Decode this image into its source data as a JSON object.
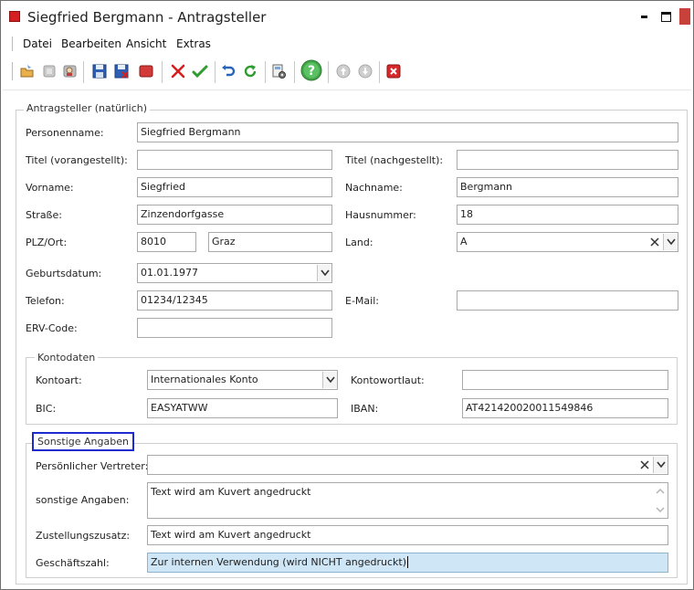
{
  "window": {
    "title": "Siegfried Bergmann - Antragsteller",
    "colors": {
      "close": "#c8413a",
      "app_icon": "#d42020",
      "focus_border": "#1c2bd0",
      "selected_bg": "#cfe6f7"
    }
  },
  "menu": [
    "Datei",
    "Bearbeiten",
    "Ansicht",
    "Extras"
  ],
  "toolbar": {
    "icons": [
      "open-folder-icon",
      "disabled-doc-icon",
      "user-search-icon",
      "save-icon",
      "save-close-icon",
      "stop-icon",
      "delete-cross-icon",
      "confirm-check-icon",
      "undo-icon",
      "refresh-icon",
      "settings-icon",
      "help-icon",
      "previous-icon",
      "next-icon",
      "close-icon"
    ]
  },
  "applicant": {
    "legend": "Antragsteller (natürlich)",
    "personenname_label": "Personenname:",
    "personenname": "Siegfried Bergmann",
    "titel_vor_label": "Titel (vorangestellt):",
    "titel_vor": "",
    "titel_nach_label": "Titel (nachgestellt):",
    "titel_nach": "",
    "vorname_label": "Vorname:",
    "vorname": "Siegfried",
    "nachname_label": "Nachname:",
    "nachname": "Bergmann",
    "strasse_label": "Straße:",
    "strasse": "Zinzendorfgasse",
    "hausnummer_label": "Hausnummer:",
    "hausnummer": "18",
    "plzort_label": "PLZ/Ort:",
    "plz": "8010",
    "ort": "Graz",
    "land_label": "Land:",
    "land": "A",
    "geburtsdatum_label": "Geburtsdatum:",
    "geburtsdatum": "01.01.1977",
    "telefon_label": "Telefon:",
    "telefon": "01234/12345",
    "email_label": "E-Mail:",
    "email": "",
    "erv_label": "ERV-Code:",
    "erv": ""
  },
  "konto": {
    "legend": "Kontodaten",
    "kontoart_label": "Kontoart:",
    "kontoart": "Internationales Konto",
    "kontowortlaut_label": "Kontowortlaut:",
    "kontowortlaut": "",
    "bic_label": "BIC:",
    "bic": "EASYATWW",
    "iban_label": "IBAN:",
    "iban": "AT421420020011549846"
  },
  "sonstige": {
    "legend": "Sonstige Angaben",
    "vertreter_label": "Persönlicher Vertreter:",
    "vertreter": "",
    "angaben_label": "sonstige Angaben:",
    "angaben": "Text wird am Kuvert angedruckt",
    "zustellung_label": "Zustellungszusatz:",
    "zustellung": "Text wird am Kuvert angedruckt",
    "gz_label": "Geschäftszahl:",
    "gz": "Zur internen Verwendung (wird NICHT angedruckt)"
  }
}
